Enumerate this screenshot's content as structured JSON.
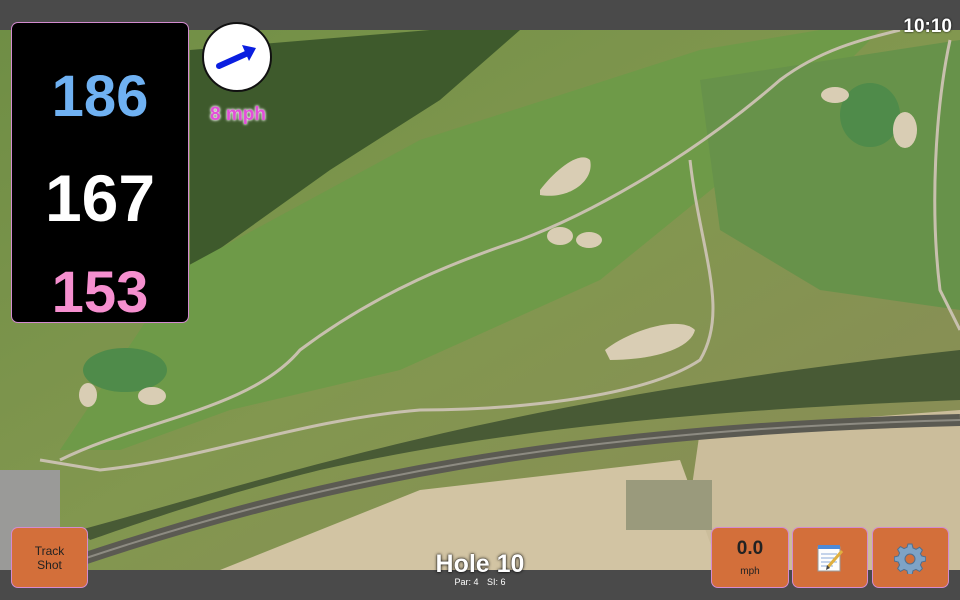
{
  "status": {
    "clock": "10:10"
  },
  "distances": {
    "back": "186",
    "middle": "167",
    "front": "153",
    "colors": {
      "back": "#6fb1f2",
      "middle": "#ffffff",
      "front": "#f58fcf"
    }
  },
  "wind": {
    "icon": "wind-arrow-icon",
    "speed_label": "8 mph",
    "arrow_color": "#0a1ee0"
  },
  "hole": {
    "title": "Hole 10",
    "par_label": "Par: 4",
    "si_label": "SI: 6"
  },
  "buttons": {
    "track_shot_line1": "Track",
    "track_shot_line2": "Shot",
    "speed_value": "0.0",
    "speed_unit": "mph",
    "notes_icon": "notepad-icon",
    "settings_icon": "gear-icon",
    "accent_color": "#d36f3a"
  },
  "map": {
    "type": "aerial-course-map"
  }
}
